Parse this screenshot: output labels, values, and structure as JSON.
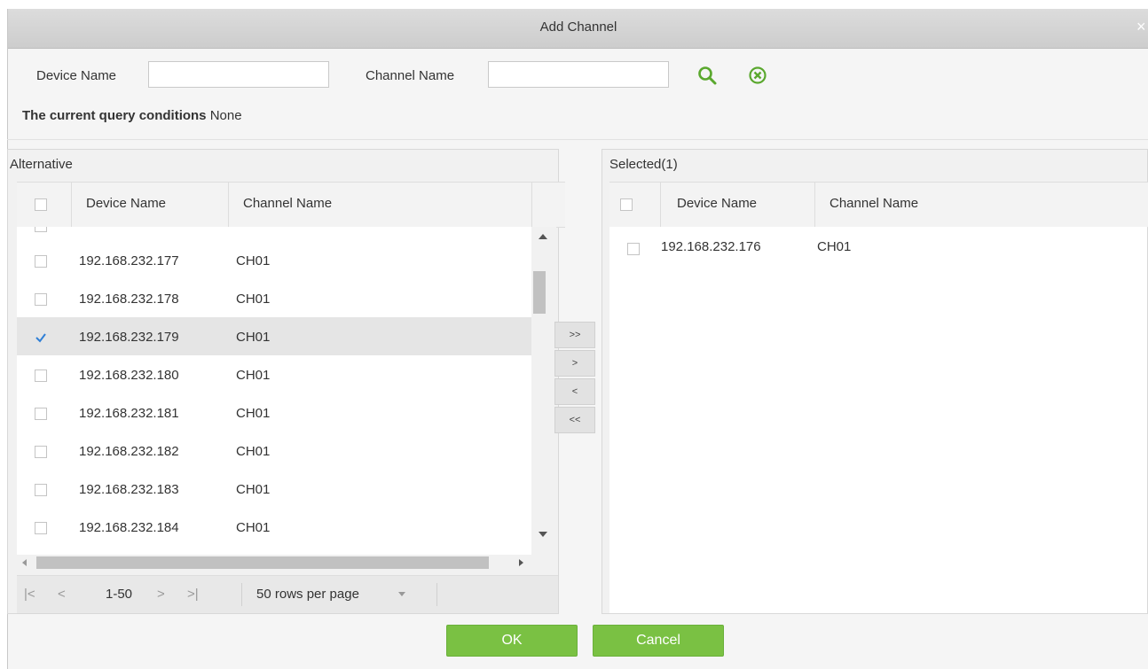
{
  "dialog": {
    "title": "Add Channel",
    "close": "×"
  },
  "search": {
    "device_name_label": "Device Name",
    "device_name_value": "",
    "channel_name_label": "Channel Name",
    "channel_name_value": ""
  },
  "query": {
    "label": "The current query conditions",
    "value": "None"
  },
  "alternative": {
    "title": "Alternative",
    "columns": [
      "Device Name",
      "Channel Name"
    ],
    "rows": [
      {
        "device": "192.168.232.177",
        "channel": "CH01",
        "checked": false
      },
      {
        "device": "192.168.232.178",
        "channel": "CH01",
        "checked": false
      },
      {
        "device": "192.168.232.179",
        "channel": "CH01",
        "checked": true
      },
      {
        "device": "192.168.232.180",
        "channel": "CH01",
        "checked": false
      },
      {
        "device": "192.168.232.181",
        "channel": "CH01",
        "checked": false
      },
      {
        "device": "192.168.232.182",
        "channel": "CH01",
        "checked": false
      },
      {
        "device": "192.168.232.183",
        "channel": "CH01",
        "checked": false
      },
      {
        "device": "192.168.232.184",
        "channel": "CH01",
        "checked": false
      }
    ],
    "pager": {
      "first": "|<",
      "prev": "<",
      "range": "1-50",
      "next": ">",
      "last": ">|",
      "rows_per_page": "50 rows per page"
    }
  },
  "transfer": {
    "move_all_right": ">>",
    "move_right": ">",
    "move_left": "<",
    "move_all_left": "<<"
  },
  "selected": {
    "title": "Selected(1)",
    "columns": [
      "Device Name",
      "Channel Name"
    ],
    "rows": [
      {
        "device": "192.168.232.176",
        "channel": "CH01",
        "checked": false
      }
    ]
  },
  "buttons": {
    "ok": "OK",
    "cancel": "Cancel"
  },
  "colors": {
    "accent_green": "#7ac143",
    "check_blue": "#2f7fd6"
  }
}
